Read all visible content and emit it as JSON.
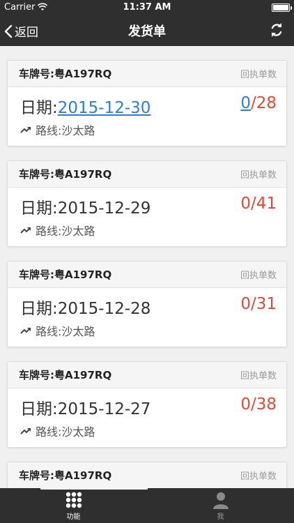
{
  "status_bar": {
    "carrier": "Carrier",
    "time": "11:37 AM"
  },
  "nav": {
    "back_label": "返回",
    "title": "发货单"
  },
  "list": {
    "items": [
      {
        "plate": "车牌号:粤A197RQ",
        "hint": "回执单数",
        "date_prefix": "日期:",
        "date": "2015-12-30",
        "done": "0",
        "sep_total": "/28",
        "route": "路线:沙太路"
      },
      {
        "plate": "车牌号:粤A197RQ",
        "hint": "回执单数",
        "date_prefix": "日期:",
        "date": "2015-12-29",
        "done": "0",
        "sep_total": "/41",
        "route": "路线:沙太路"
      },
      {
        "plate": "车牌号:粤A197RQ",
        "hint": "回执单数",
        "date_prefix": "日期:",
        "date": "2015-12-28",
        "done": "0",
        "sep_total": "/31",
        "route": "路线:沙太路"
      },
      {
        "plate": "车牌号:粤A197RQ",
        "hint": "回执单数",
        "date_prefix": "日期:",
        "date": "2015-12-27",
        "done": "0",
        "sep_total": "/38",
        "route": "路线:沙太路"
      },
      {
        "plate": "车牌号:粤A197RQ",
        "hint": "回执单数"
      }
    ]
  },
  "tabbar": {
    "tabs": [
      {
        "label": "功能",
        "icon": "grid-icon",
        "active": true
      },
      {
        "label": "我",
        "icon": "person-icon",
        "active": false
      }
    ]
  },
  "colors": {
    "bar": "#2f2f2f",
    "accent_red": "#e04a3a",
    "link_blue": "#2a7fd9"
  }
}
